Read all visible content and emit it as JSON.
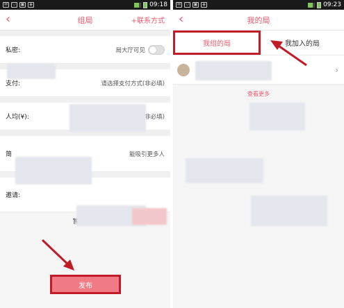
{
  "left": {
    "status_time": "09:18",
    "nav": {
      "title": "组局",
      "right_action": "+联系方式"
    },
    "privacy": {
      "label": "私密:",
      "toggle_label": "局大厅可见"
    },
    "payment": {
      "label": "支付:",
      "hint": "请选择支付方式(非必填)"
    },
    "per_person": {
      "label": "人均(¥):",
      "hint": "填人均入均额(非必填)"
    },
    "desc": {
      "label": "简",
      "hint": "能吸引更多人"
    },
    "invite": {
      "label": "邀请:"
    },
    "no_invite": "暂无邀请",
    "publish_label": "发布"
  },
  "right": {
    "status_time": "09:23",
    "nav": {
      "title": "我的局"
    },
    "tabs": [
      "我组的局",
      "我加入的局"
    ],
    "see_more": "查看更多"
  },
  "colors": {
    "accent": "#e85a6e",
    "highlight_border": "#c11b28",
    "publish_bg": "#f07b86"
  }
}
